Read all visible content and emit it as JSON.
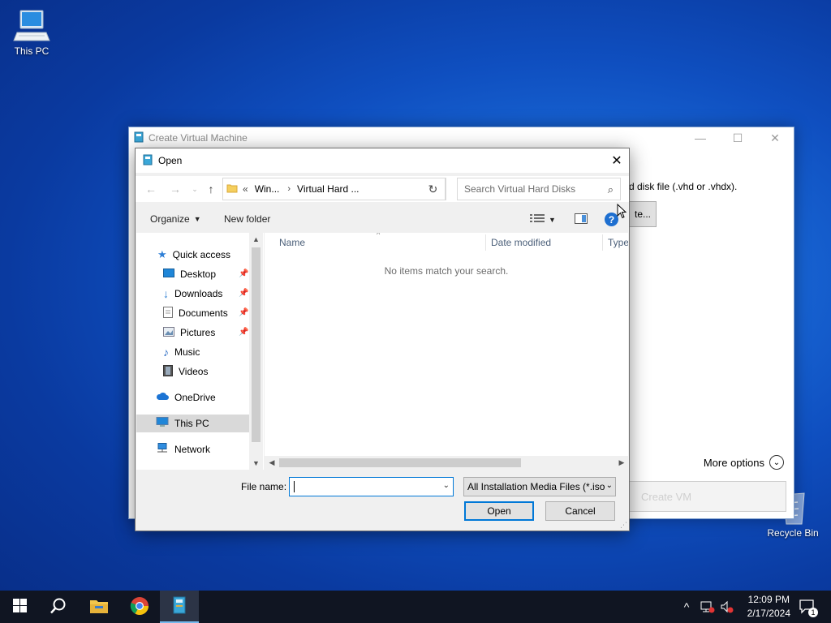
{
  "desktop": {
    "icons": [
      {
        "label": "This PC"
      },
      {
        "label": "Recycle Bin"
      }
    ]
  },
  "bg_window": {
    "title": "Create Virtual Machine",
    "description_fragment": "rd disk file (.vhd or .vhdx).",
    "browse_fragment": "te...",
    "more_options": "More options",
    "create_fragment": "Create VM"
  },
  "dialog": {
    "title": "Open",
    "address": {
      "overflow": "«",
      "segments": [
        "Win...",
        "Virtual Hard ..."
      ]
    },
    "search_placeholder": "Search Virtual Hard Disks",
    "toolbar": {
      "organize": "Organize",
      "new_folder": "New folder"
    },
    "nav": {
      "quick_access": "Quick access",
      "items": [
        {
          "label": "Desktop",
          "pinned": true
        },
        {
          "label": "Downloads",
          "pinned": true
        },
        {
          "label": "Documents",
          "pinned": true
        },
        {
          "label": "Pictures",
          "pinned": true
        },
        {
          "label": "Music",
          "pinned": false
        },
        {
          "label": "Videos",
          "pinned": false
        }
      ],
      "onedrive": "OneDrive",
      "this_pc": "This PC",
      "network": "Network"
    },
    "columns": [
      "Name",
      "Date modified",
      "Type"
    ],
    "empty_message": "No items match your search.",
    "file_name_label": "File name:",
    "file_name_value": "",
    "filter_value": "All Installation Media Files (*.iso",
    "open_label": "Open",
    "cancel_label": "Cancel"
  },
  "taskbar": {
    "time": "12:09 PM",
    "date": "2/17/2024",
    "notification_count": "1"
  },
  "colors": {
    "accent": "#0078d7",
    "taskbar": "#101522"
  }
}
